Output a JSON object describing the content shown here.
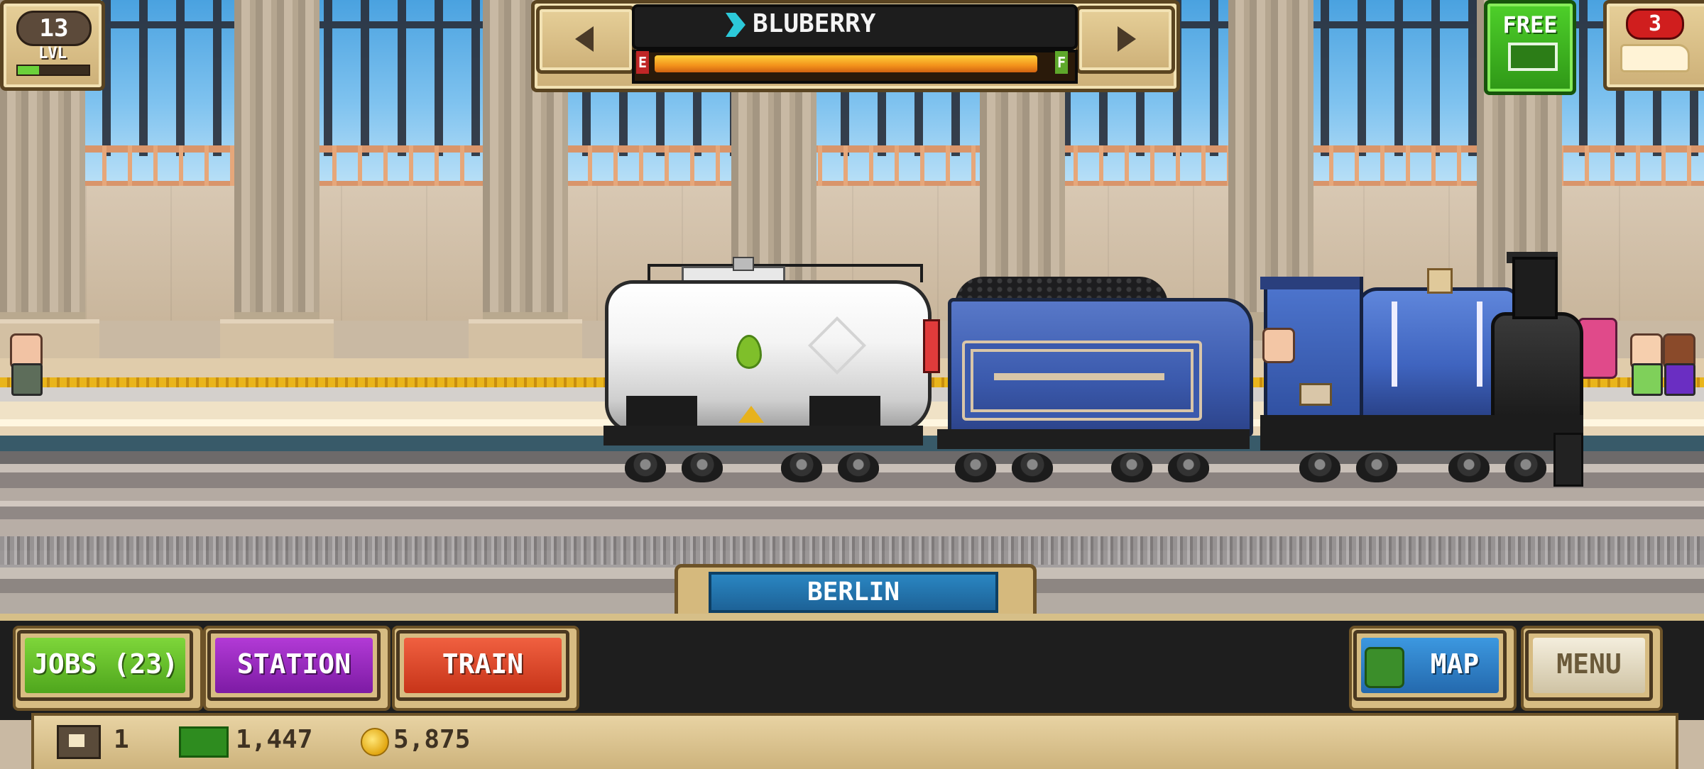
{
  "hud": {
    "level": {
      "number": "13",
      "label": "LVL",
      "progress": 0.3
    },
    "train_selector": {
      "name": "BLUBERRY",
      "fuel_empty_label": "E",
      "fuel_full_label": "F",
      "fuel_level": 0.97
    },
    "free_button": {
      "label": "FREE",
      "icon": "cash-icon"
    },
    "trains_badge": {
      "count": "3",
      "icon": "train-icon"
    }
  },
  "scene": {
    "city": "BERLIN"
  },
  "bottom_bar": {
    "jobs_label": "JOBS (23)",
    "station_label": "STATION",
    "train_label": "TRAIN",
    "map_label": "MAP",
    "menu_label": "MENU"
  },
  "status": {
    "cars": "1",
    "cash": "1,447",
    "coins": "5,875"
  },
  "colors": {
    "jobs": "#5fb52a",
    "station": "#9a2bc2",
    "train": "#e04a2b",
    "map": "#2f7fc4",
    "free": "#3fb51f"
  }
}
